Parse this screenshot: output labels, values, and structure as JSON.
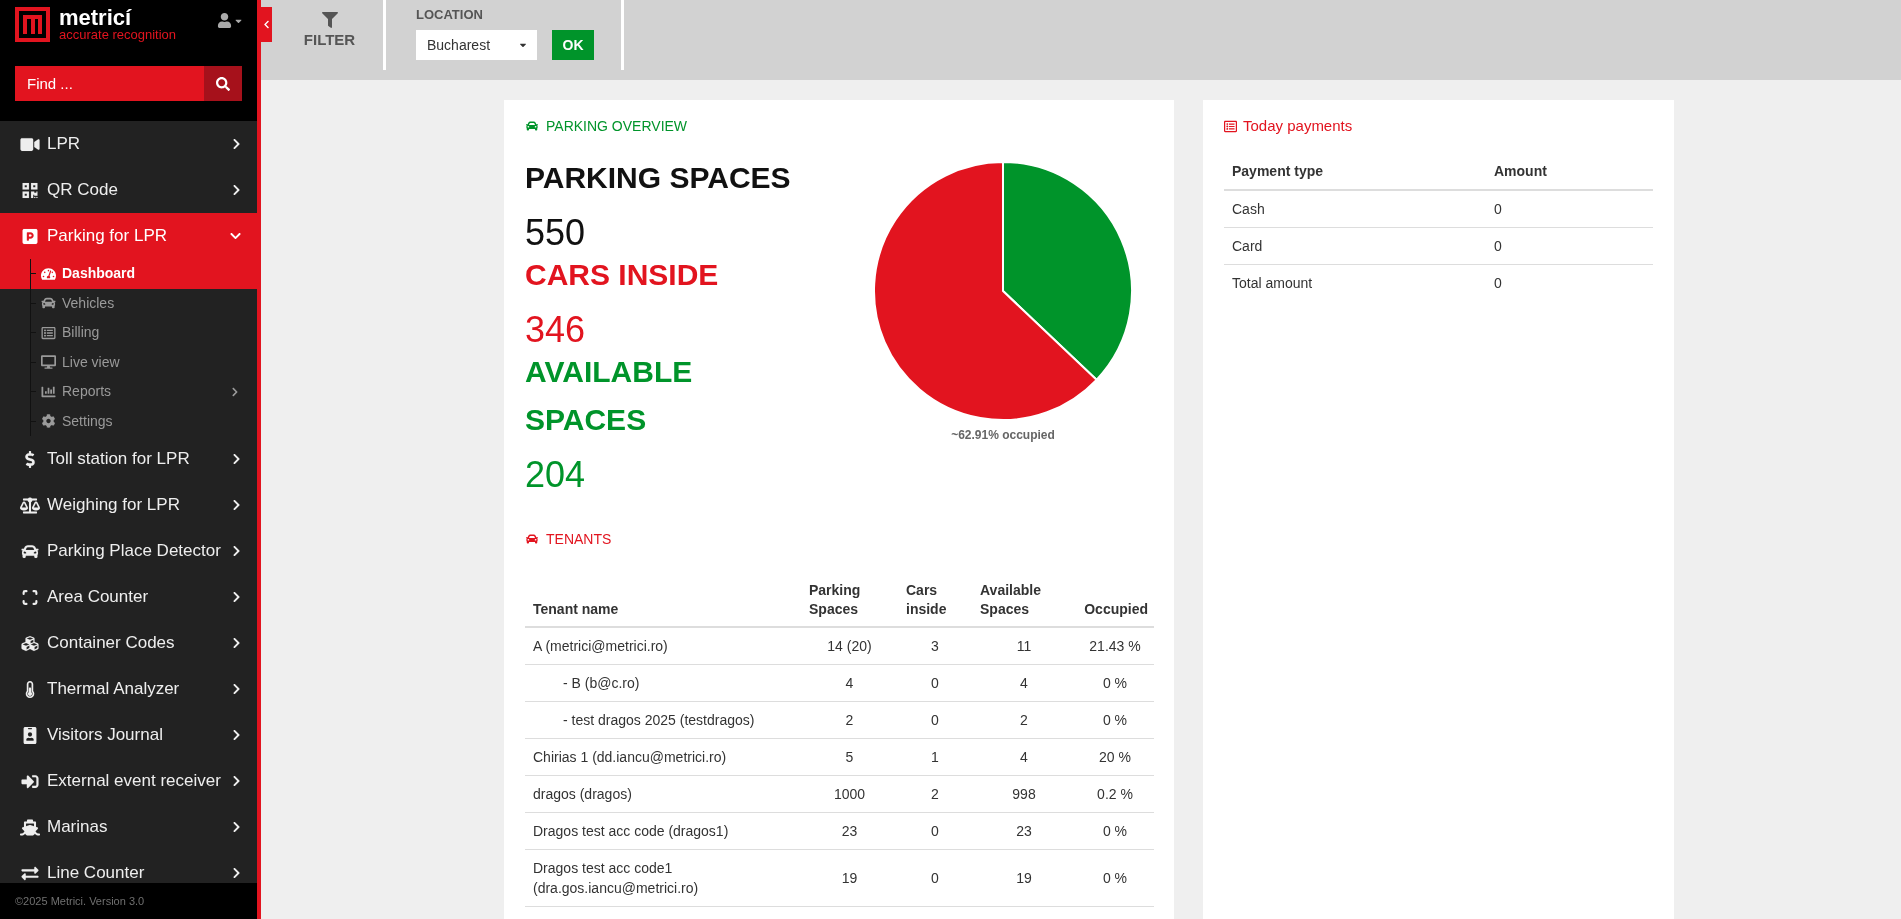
{
  "sidebar": {
    "logo": {
      "name": "metricí",
      "tagline": "accurate recognition"
    },
    "search": {
      "placeholder": "Find ..."
    },
    "menu": [
      {
        "label": "LPR",
        "expanded": false
      },
      {
        "label": "QR Code",
        "expanded": false
      },
      {
        "label": "Parking for LPR",
        "expanded": true,
        "children": [
          {
            "label": "Dashboard",
            "selected": true,
            "expandable": false
          },
          {
            "label": "Vehicles",
            "selected": false,
            "expandable": false
          },
          {
            "label": "Billing",
            "selected": false,
            "expandable": false
          },
          {
            "label": "Live view",
            "selected": false,
            "expandable": false
          },
          {
            "label": "Reports",
            "selected": false,
            "expandable": true
          },
          {
            "label": "Settings",
            "selected": false,
            "expandable": false
          }
        ]
      },
      {
        "label": "Toll station for LPR",
        "expanded": false
      },
      {
        "label": "Weighing for LPR",
        "expanded": false
      },
      {
        "label": "Parking Place Detector",
        "expanded": false
      },
      {
        "label": "Area Counter",
        "expanded": false
      },
      {
        "label": "Container Codes",
        "expanded": false
      },
      {
        "label": "Thermal Analyzer",
        "expanded": false
      },
      {
        "label": "Visitors Journal",
        "expanded": false
      },
      {
        "label": "External event receiver",
        "expanded": false
      },
      {
        "label": "Marinas",
        "expanded": false
      },
      {
        "label": "Line Counter",
        "expanded": false
      }
    ],
    "footer": "©2025 Metrici. Version 3.0"
  },
  "filter_bar": {
    "filter_label": "FILTER",
    "location": {
      "label": "LOCATION",
      "value": "Bucharest"
    },
    "ok_button": "OK"
  },
  "parking_overview": {
    "title": "PARKING OVERVIEW",
    "stats": [
      {
        "label": "PARKING SPACES",
        "value": "550",
        "color": "#111111"
      },
      {
        "label": "CARS INSIDE",
        "value": "346",
        "color": "#e2141f"
      },
      {
        "label": "AVAILABLE SPACES",
        "value": "204",
        "color": "#00942a"
      }
    ],
    "chart_data": {
      "type": "pie",
      "colors": [
        "#00942a",
        "#e2141f"
      ],
      "series": [
        {
          "values": [
            37.09,
            62.91
          ]
        }
      ]
    },
    "caption": "~62.91% occupied"
  },
  "tenants": {
    "title": "TENANTS",
    "columns": [
      "Tenant name",
      "Parking Spaces",
      "Cars inside",
      "Available Spaces",
      "Occupied"
    ],
    "rows": [
      {
        "cells": [
          "A (metrici@metrici.ro)",
          "14 (20)",
          "3",
          "11",
          "21.43 %"
        ],
        "children": [
          {
            "cells": [
              "- B (b@c.ro)",
              "4",
              "0",
              "4",
              "0 %"
            ]
          },
          {
            "cells": [
              "- test dragos 2025 (testdragos)",
              "2",
              "0",
              "2",
              "0 %"
            ]
          }
        ]
      },
      {
        "cells": [
          "Chirias 1 (dd.iancu@metrici.ro)",
          "5",
          "1",
          "4",
          "20 %"
        ]
      },
      {
        "cells": [
          "dragos (dragos)",
          "1000",
          "2",
          "998",
          "0.2 %"
        ]
      },
      {
        "cells": [
          "Dragos test acc code (dragos1)",
          "23",
          "0",
          "23",
          "0 %"
        ]
      },
      {
        "cells": [
          "Dragos test acc code1 (dra.gos.iancu@metrici.ro)",
          "19",
          "0",
          "19",
          "0 %"
        ]
      }
    ]
  },
  "today_payments": {
    "title": "Today payments",
    "columns": [
      "Payment type",
      "Amount"
    ],
    "rows": [
      [
        "Cash",
        "0"
      ],
      [
        "Card",
        "0"
      ],
      [
        "Total amount",
        "0"
      ]
    ]
  }
}
